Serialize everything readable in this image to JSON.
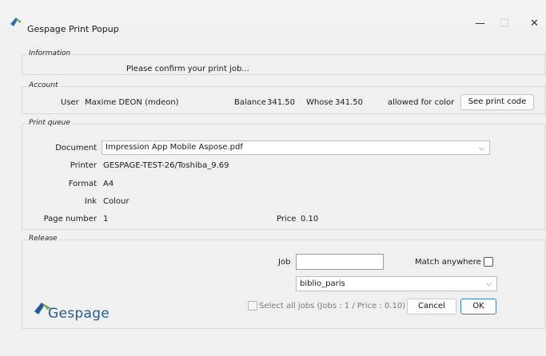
{
  "window": {
    "title": "Gespage Print Popup",
    "controls": {
      "minimize": "—",
      "maximize": "☐",
      "close": "✕"
    }
  },
  "information": {
    "legend": "Information",
    "message": "Please confirm your print job..."
  },
  "account": {
    "legend": "Account",
    "user_label": "User",
    "user_value": "Maxime DEON (mdeon)",
    "balance_label": "Balance",
    "balance_value": "341.50",
    "whose_label": "Whose",
    "whose_value": "341.50",
    "color_text": "allowed for color",
    "see_print_code_button": "See print code"
  },
  "print_queue": {
    "legend": "Print queue",
    "document_label": "Document",
    "document_value": "Impression App Mobile Aspose.pdf",
    "printer_label": "Printer",
    "printer_value": "GESPAGE-TEST-26/Toshiba_9.69",
    "format_label": "Format",
    "format_value": "A4",
    "ink_label": "Ink",
    "ink_value": "Colour",
    "page_number_label": "Page number",
    "page_number_value": "1",
    "price_label": "Price",
    "price_value": "0.10"
  },
  "release": {
    "legend": "Release",
    "job_label": "Job",
    "job_value": "",
    "match_anywhere_label": "Match anywhere",
    "match_anywhere_checked": false,
    "location_value": "biblio_paris",
    "select_all_label": "Select all jobs (Jobs : 1 / Price : 0.10)",
    "select_all_checked": false,
    "cancel_button": "Cancel",
    "ok_button": "OK"
  },
  "logo": {
    "text": "Gespage"
  },
  "colors": {
    "logo_blue": "#1f5c99",
    "logo_green": "#6ab04c",
    "accent_border": "#3b82c4"
  },
  "icons": [
    "app-icon",
    "minimize-icon",
    "maximize-icon",
    "close-icon",
    "chevron-down-icon",
    "gespage-logo"
  ]
}
